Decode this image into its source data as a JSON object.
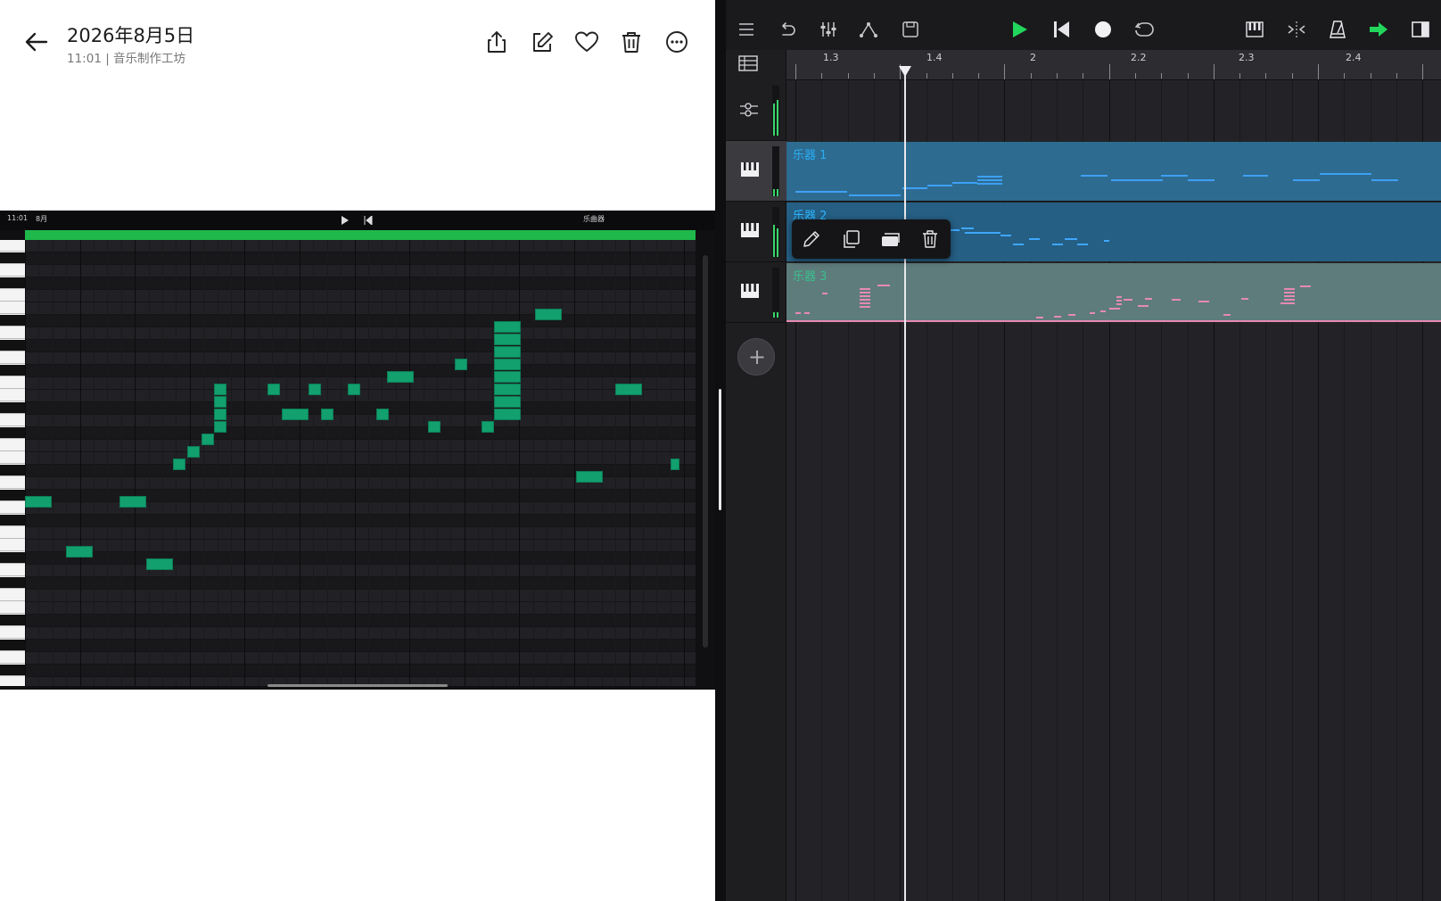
{
  "viewer": {
    "title": "2026年8月5日",
    "subtitle": "11:01 | 音乐制作工坊",
    "actions": [
      "share",
      "edit",
      "favorite",
      "delete",
      "more"
    ]
  },
  "screenshot": {
    "status_time": "11:01",
    "status_date": "8月",
    "status_right": "乐曲器"
  },
  "daw": {
    "ruler_labels": [
      "1.3",
      "1.4",
      "2",
      "2.2",
      "2.3",
      "2.4"
    ],
    "tracks": [
      {
        "name": "乐器 1",
        "color": "#2f6f96"
      },
      {
        "name": "乐器 2",
        "color": "#2e6f95"
      },
      {
        "name": "乐器 3",
        "color": "#5e7c7c"
      }
    ],
    "colors": {
      "play": "#22d65c",
      "note_blue": "#3fa7ff",
      "note_pink": "#e58ab4",
      "piano_note": "#12a06e",
      "ruler_green": "#1fb84a"
    },
    "popup_actions": [
      "edit",
      "duplicate",
      "copy",
      "delete"
    ]
  }
}
